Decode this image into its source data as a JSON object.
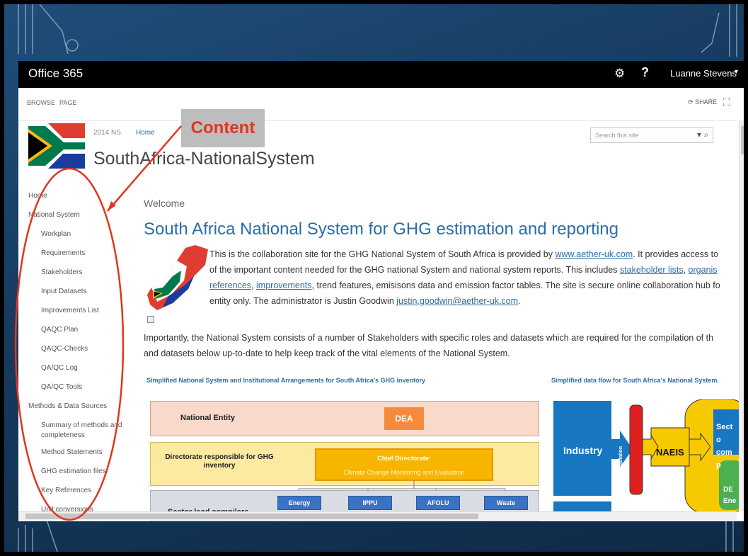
{
  "suite_bar": {
    "brand": "Office 365",
    "gear_icon": "gear-icon",
    "help_label": "?",
    "user_name": "Luanne Stevens",
    "user_caret": "▾"
  },
  "ribbon": {
    "browse": "BROWSE",
    "page": "PAGE",
    "share": "SHARE",
    "focus_icon": "focus-icon"
  },
  "header": {
    "breadcrumb": [
      "2014 NS",
      "Home"
    ],
    "site_title": "SouthAfrica-NationalSystem",
    "search_placeholder": "Search this site"
  },
  "annotation": {
    "label": "Content",
    "color": "#e2351e"
  },
  "nav": [
    {
      "label": "Home",
      "level": 0
    },
    {
      "label": "National System",
      "level": 0
    },
    {
      "label": "Workplan",
      "level": 1
    },
    {
      "label": "Requirements",
      "level": 1
    },
    {
      "label": "Stakeholders",
      "level": 1
    },
    {
      "label": "Input Datasets",
      "level": 1
    },
    {
      "label": "Improvements List",
      "level": 1
    },
    {
      "label": "QAQC Plan",
      "level": 1
    },
    {
      "label": "QAQC-Checks",
      "level": 1
    },
    {
      "label": "QA/QC Log",
      "level": 1
    },
    {
      "label": "QA/QC Tools",
      "level": 1
    },
    {
      "label": "Methods & Data Sources",
      "level": 0
    },
    {
      "label": "Summary of methods and completeness",
      "level": 1
    },
    {
      "label": "Method Statements",
      "level": 1
    },
    {
      "label": "GHG estimation files",
      "level": 1
    },
    {
      "label": "Key References",
      "level": 1
    },
    {
      "label": "Unit conversions",
      "level": 1
    }
  ],
  "main": {
    "welcome": "Welcome",
    "heading": "South Africa National System for GHG estimation and reporting",
    "intro": {
      "line1_a": "This is the collaboration site for the GHG National System of South Africa is provided by ",
      "link_aether": "www.aether-uk.com",
      "line1_b": ".  It provides access to",
      "line2_a": "of the important content needed for the GHG national System and national system reports.  This includes ",
      "link_stakeholder": "stakeholder lists",
      "line2_comma": ", ",
      "link_organis": "organis",
      "link_references": "references",
      "line3_comma": ", ",
      "link_improvements": "improvements",
      "line3_b": ", trend features, emisisons data and emission factor tables.  The site is secure online collaboration hub fo",
      "line4_a": "entity only.  The administrator is Justin Goodwin ",
      "link_email": "justin.goodwin@aether-uk.com",
      "line4_b": "."
    },
    "importantly_line1": "Importantly, the National System consists of a number of Stakeholders with specific roles and datasets which are required for the compilation of th",
    "importantly_line2": "and datasets below up-to-date to help keep track of the vital elements of the National System."
  },
  "diagram1": {
    "title": "Simplified National System and Institutional Arrangements for South Africa's GHG inventory",
    "national_entity": "National Entity",
    "dea": "DEA",
    "directorate": "Directorate responsible for GHG inventory",
    "chief_title": "Chief Directorate:",
    "chief_sub": "Climate Change Monitoring and Evaluation",
    "sector_compilers": "Sector lead compilers",
    "sectors": [
      "Energy",
      "IPPU",
      "AFOLU",
      "Waste"
    ]
  },
  "diagram2": {
    "title": "Simplified data flow for South Africa's National System.",
    "industry": "Industry",
    "ghg_reg": "GHG Regulation",
    "naeis": "NAEIS",
    "sector_comp": "Secto comp",
    "de_ene": "DE Ene"
  }
}
